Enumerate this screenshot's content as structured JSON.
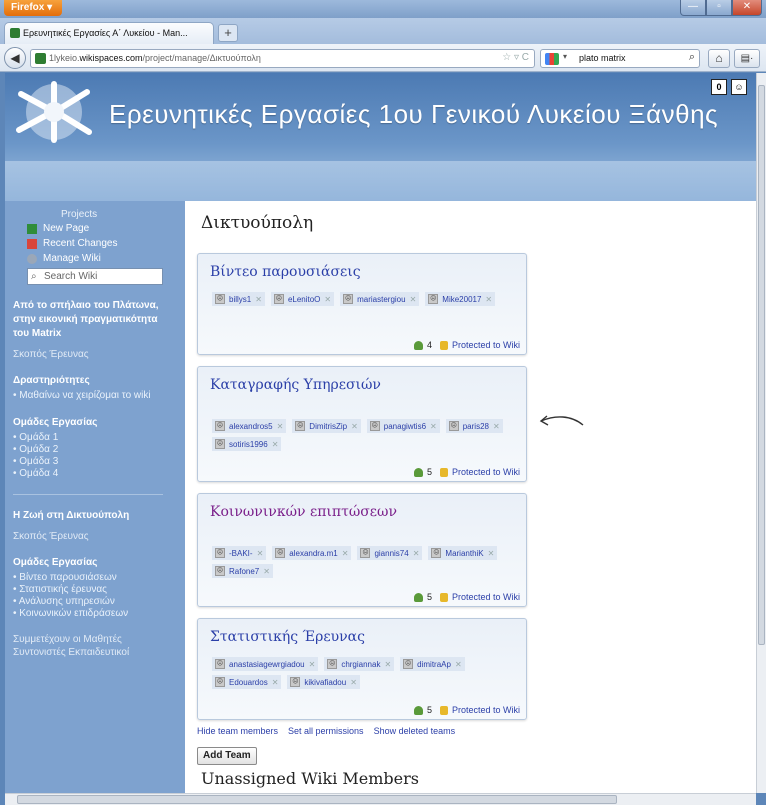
{
  "browser": {
    "app_button": "Firefox ▾",
    "tab_title": "Ερευνητικές Εργασίες Α΄ Λυκείου - Man...",
    "url_prefix": "1lykeio.",
    "url_host": "wikispaces.com",
    "url_path": "/project/manage/Δικτυούπολη",
    "search_text": "plato matrix"
  },
  "header": {
    "site_title": "Ερευνητικές Εργασίες 1ου Γενικού Λυκείου Ξάνθης",
    "badge_left": "0",
    "badge_right": "☺"
  },
  "sidebar": {
    "projects": "Projects",
    "links": [
      "New Page",
      "Recent Changes",
      "Manage Wiki"
    ],
    "search_placeholder": "Search Wiki",
    "section1_title": "Από το σπήλαιο του Πλάτωνα, στην εικονική πραγματικότητα του Matrix",
    "section1_purpose": "Σκοπός Έρευνας",
    "activities_title": "Δραστηριότητες",
    "activities": [
      "Μαθαίνω να χειρίζομαι το wiki"
    ],
    "groups_title": "Ομάδες Εργασίας",
    "groups": [
      "Ομάδα 1",
      "Ομάδα 2",
      "Ομάδα 3",
      "Ομάδα 4"
    ],
    "section2_title": "Η Ζωή στη Δικτυούπολη",
    "section2_purpose": "Σκοπός Έρευνας",
    "groups2_title": "Ομάδες Εργασίας",
    "groups2": [
      "Βίντεο παρουσιάσεων",
      "Στατιστικής έρευνας",
      "Ανάλυσης υπηρεσιών",
      "Κοινωνικών επιδράσεων"
    ],
    "footer1": "Συμμετέχουν οι Μαθητές",
    "footer2": "Συντονιστές Εκπαιδευτικοί"
  },
  "main": {
    "title": "Δικτυούπολη",
    "teams": [
      {
        "name": "Βίντεο παρουσιάσεις",
        "members": [
          "billys1",
          "eLenitoO",
          "mariastergiou",
          "Mike20017"
        ],
        "count": "4",
        "protection": "Protected to Wiki"
      },
      {
        "name": "Καταγραφής Υπηρεσιών",
        "members": [
          "alexandros5",
          "DimitrisZip",
          "panagiwtis6",
          "paris28",
          "sotiris1996"
        ],
        "count": "5",
        "protection": "Protected to Wiki"
      },
      {
        "name": "Κοινωνινκών επιπτώσεων",
        "members": [
          "-BAKI-",
          "alexandra.m1",
          "giannis74",
          "MarianthiK",
          "Rafone7"
        ],
        "count": "5",
        "protection": "Protected to Wiki"
      },
      {
        "name": "Στατιστικής Έρευνας",
        "members": [
          "anastasiagewrgiadou",
          "chrgiannak",
          "dimitraAp",
          "Edouardos",
          "kikivafiadou"
        ],
        "count": "5",
        "protection": "Protected to Wiki"
      }
    ],
    "link_hide": "Hide team members",
    "link_perms": "Set all permissions",
    "link_deleted": "Show deleted teams",
    "add_team": "Add Team",
    "unassigned_title": "Unassigned Wiki Members"
  },
  "colors": {
    "link": "#2b3fa8",
    "purple_title": "#7a1f8a",
    "sidebar_bg": "#7ea2cf"
  }
}
